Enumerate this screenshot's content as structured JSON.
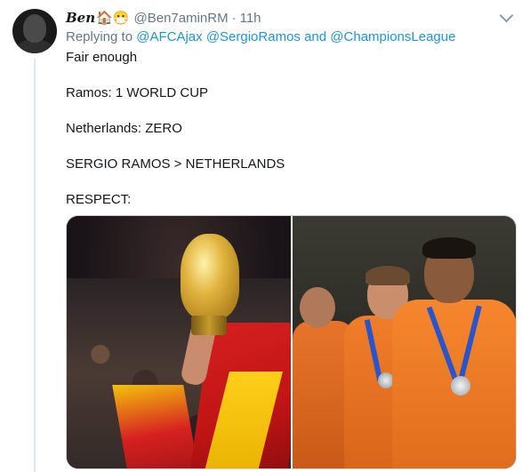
{
  "tweet": {
    "display_name": "Ben",
    "name_emojis": "🏠😷",
    "handle": "@Ben7aminRM",
    "separator": "·",
    "time": "11h",
    "reply": {
      "prefix": "Replying to",
      "mention1": "@AFCAjax",
      "mention2": "@SergioRamos",
      "conjunction": "and",
      "mention3": "@ChampionsLeague"
    },
    "lines": [
      "Fair enough",
      "",
      "Ramos: 1 WORLD CUP",
      "",
      "Netherlands: ZERO",
      "",
      "SERGIO RAMOS > NETHERLANDS",
      "",
      "RESPECT:"
    ]
  },
  "media": {
    "left_image": "photo-world-cup-trophy-celebration",
    "right_image": "photo-netherlands-players-dejected"
  },
  "colors": {
    "link": "#1b95e0",
    "secondary_text": "#657786",
    "primary_text": "#14171a",
    "divider": "#e1e8ed"
  }
}
